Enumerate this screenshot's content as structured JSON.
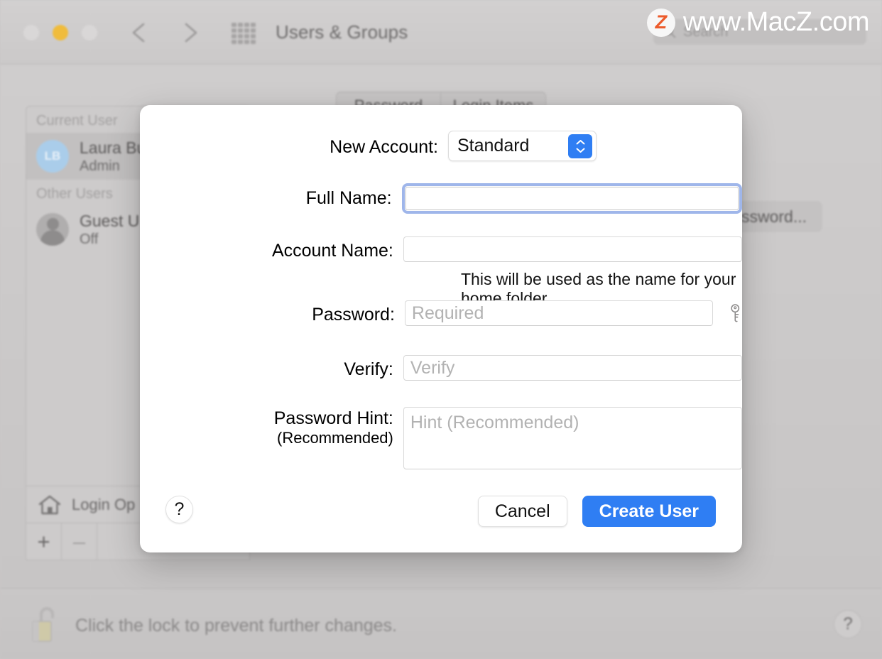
{
  "window": {
    "title": "Users & Groups",
    "traffic_lights": [
      "close-button",
      "minimize-button",
      "zoom-button"
    ],
    "back_icon": "chevron-left-icon",
    "forward_icon": "chevron-right-icon",
    "grid_icon": "grid-apps-icon",
    "search": {
      "icon": "search-icon",
      "placeholder": "Search"
    }
  },
  "tabs": [
    {
      "label": "Password"
    },
    {
      "label": "Login Items"
    }
  ],
  "sidebar": {
    "groups": [
      {
        "label": "Current User",
        "users": [
          {
            "name": "Laura Bu",
            "role": "Admin",
            "initials": "LB",
            "selected": true
          }
        ]
      },
      {
        "label": "Other Users",
        "users": [
          {
            "name": "Guest U",
            "role": "Off",
            "initials": "",
            "selected": false
          }
        ]
      }
    ],
    "login_options": {
      "label": "Login Op",
      "icon": "home-icon"
    },
    "add_button": "+",
    "remove_button": "–"
  },
  "main": {
    "change_password_button": "ssword..."
  },
  "lock_bar": {
    "icon": "unlocked-padlock-icon",
    "text": "Click the lock to prevent further changes.",
    "help_button": "?"
  },
  "dialog": {
    "new_account": {
      "label": "New Account:",
      "selected": "Standard",
      "stepper_icon": "chevron-up-down-icon",
      "options": [
        "Standard"
      ]
    },
    "full_name": {
      "label": "Full Name:",
      "value": "",
      "placeholder": "",
      "focused": true
    },
    "account_name": {
      "label": "Account Name:",
      "value": "",
      "placeholder": "",
      "note": "This will be used as the name for your home folder."
    },
    "password": {
      "label": "Password:",
      "value": "",
      "placeholder": "Required",
      "key_icon": "key-icon"
    },
    "verify": {
      "label": "Verify:",
      "value": "",
      "placeholder": "Verify"
    },
    "password_hint": {
      "label": "Password Hint:",
      "sublabel": "(Recommended)",
      "value": "",
      "placeholder": "Hint (Recommended)"
    },
    "help_button": "?",
    "cancel_button": "Cancel",
    "create_button": "Create User"
  },
  "watermark": {
    "logo_letter": "Z",
    "text": "www.MacZ.com"
  },
  "colors": {
    "accent_blue": "#2f7ef3",
    "focus_ring": "#9fb6ea",
    "window_bg": "#c9c7c7",
    "dialog_bg": "#ffffff",
    "watermark_orange": "#ec5b2b"
  }
}
